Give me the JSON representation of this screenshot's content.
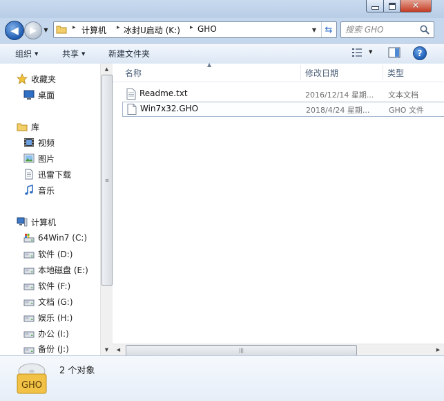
{
  "window": {
    "caption_close": "✕"
  },
  "address": {
    "crumbs": [
      "计算机",
      "冰封U启动 (K:)",
      "GHO"
    ],
    "separator": "▸"
  },
  "search": {
    "placeholder": "搜索 GHO"
  },
  "toolbar": {
    "organize": "组织",
    "share": "共享",
    "new_folder": "新建文件夹",
    "help": "?"
  },
  "nav_pane": {
    "favorites": {
      "label": "收藏夹",
      "items": [
        {
          "label": "桌面",
          "icon": "desktop-icon"
        }
      ]
    },
    "libraries": {
      "label": "库",
      "items": [
        {
          "label": "视频",
          "icon": "video-icon"
        },
        {
          "label": "图片",
          "icon": "picture-icon"
        },
        {
          "label": "迅雷下载",
          "icon": "document-icon"
        },
        {
          "label": "音乐",
          "icon": "music-icon"
        }
      ]
    },
    "computer": {
      "label": "计算机",
      "drives": [
        {
          "label": "64Win7  (C:)",
          "icon": "system-drive-icon"
        },
        {
          "label": "软件 (D:)",
          "icon": "drive-icon"
        },
        {
          "label": "本地磁盘 (E:)",
          "icon": "drive-icon"
        },
        {
          "label": "软件 (F:)",
          "icon": "drive-icon"
        },
        {
          "label": "文档 (G:)",
          "icon": "drive-icon"
        },
        {
          "label": "娱乐 (H:)",
          "icon": "drive-icon"
        },
        {
          "label": "办公 (I:)",
          "icon": "drive-icon"
        },
        {
          "label": "备份 (J:)",
          "icon": "drive-icon"
        }
      ]
    }
  },
  "columns": {
    "name": "名称",
    "modified": "修改日期",
    "type": "类型"
  },
  "files": [
    {
      "name": "Readme.txt",
      "modified": "2016/12/14 星期...",
      "type": "文本文档",
      "icon": "text-file-icon",
      "selected": false
    },
    {
      "name": "Win7x32.GHO",
      "modified": "2018/4/24 星期...",
      "type": "GHO 文件",
      "icon": "file-icon",
      "selected": true
    }
  ],
  "details": {
    "count_text": "2 个对象",
    "thumb_label": "GHO"
  },
  "colors": {
    "frame": "#c5d7ec",
    "accent_blue": "#1f5bb0",
    "selection_border": "#a9b9cf"
  }
}
